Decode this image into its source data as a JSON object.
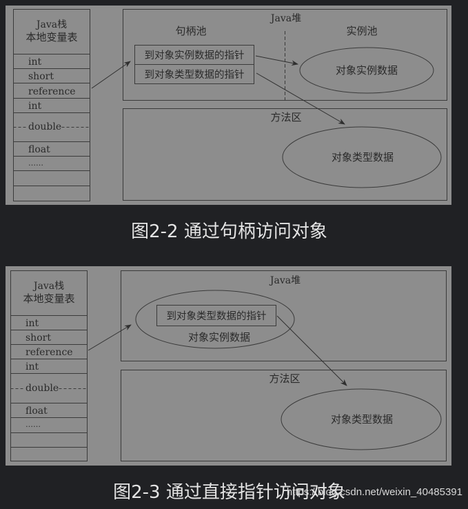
{
  "figures": [
    {
      "id": "fig-2-2",
      "caption": "图2-2 通过句柄访问对象",
      "stack": {
        "title_line1": "Java栈",
        "title_line2": "本地变量表",
        "rows": [
          "int",
          "short",
          "reference",
          "int",
          "double",
          "float",
          "……",
          "",
          ""
        ]
      },
      "heap": {
        "title": "Java堆",
        "handle_pool_label": "句柄池",
        "handle_entries": [
          "到对象实例数据的指针",
          "到对象类型数据的指针"
        ],
        "instance_pool_label": "实例池",
        "instance_data_label": "对象实例数据"
      },
      "method_area": {
        "title": "方法区",
        "type_data_label": "对象类型数据"
      }
    },
    {
      "id": "fig-2-3",
      "caption": "图2-3 通过直接指针访问对象",
      "stack": {
        "title_line1": "Java栈",
        "title_line2": "本地变量表",
        "rows": [
          "int",
          "short",
          "reference",
          "int",
          "double",
          "float",
          "……",
          "",
          ""
        ]
      },
      "heap": {
        "title": "Java堆",
        "type_pointer_label": "到对象类型数据的指针",
        "instance_data_label": "对象实例数据"
      },
      "method_area": {
        "title": "方法区",
        "type_data_label": "对象类型数据"
      }
    }
  ],
  "watermark": "https://blog.csdn.net/weixin_40485391",
  "colors": {
    "background": "#202124",
    "panel": "#8d8d8d",
    "line": "#3a3a3a",
    "caption_text": "#e4e4e4"
  }
}
